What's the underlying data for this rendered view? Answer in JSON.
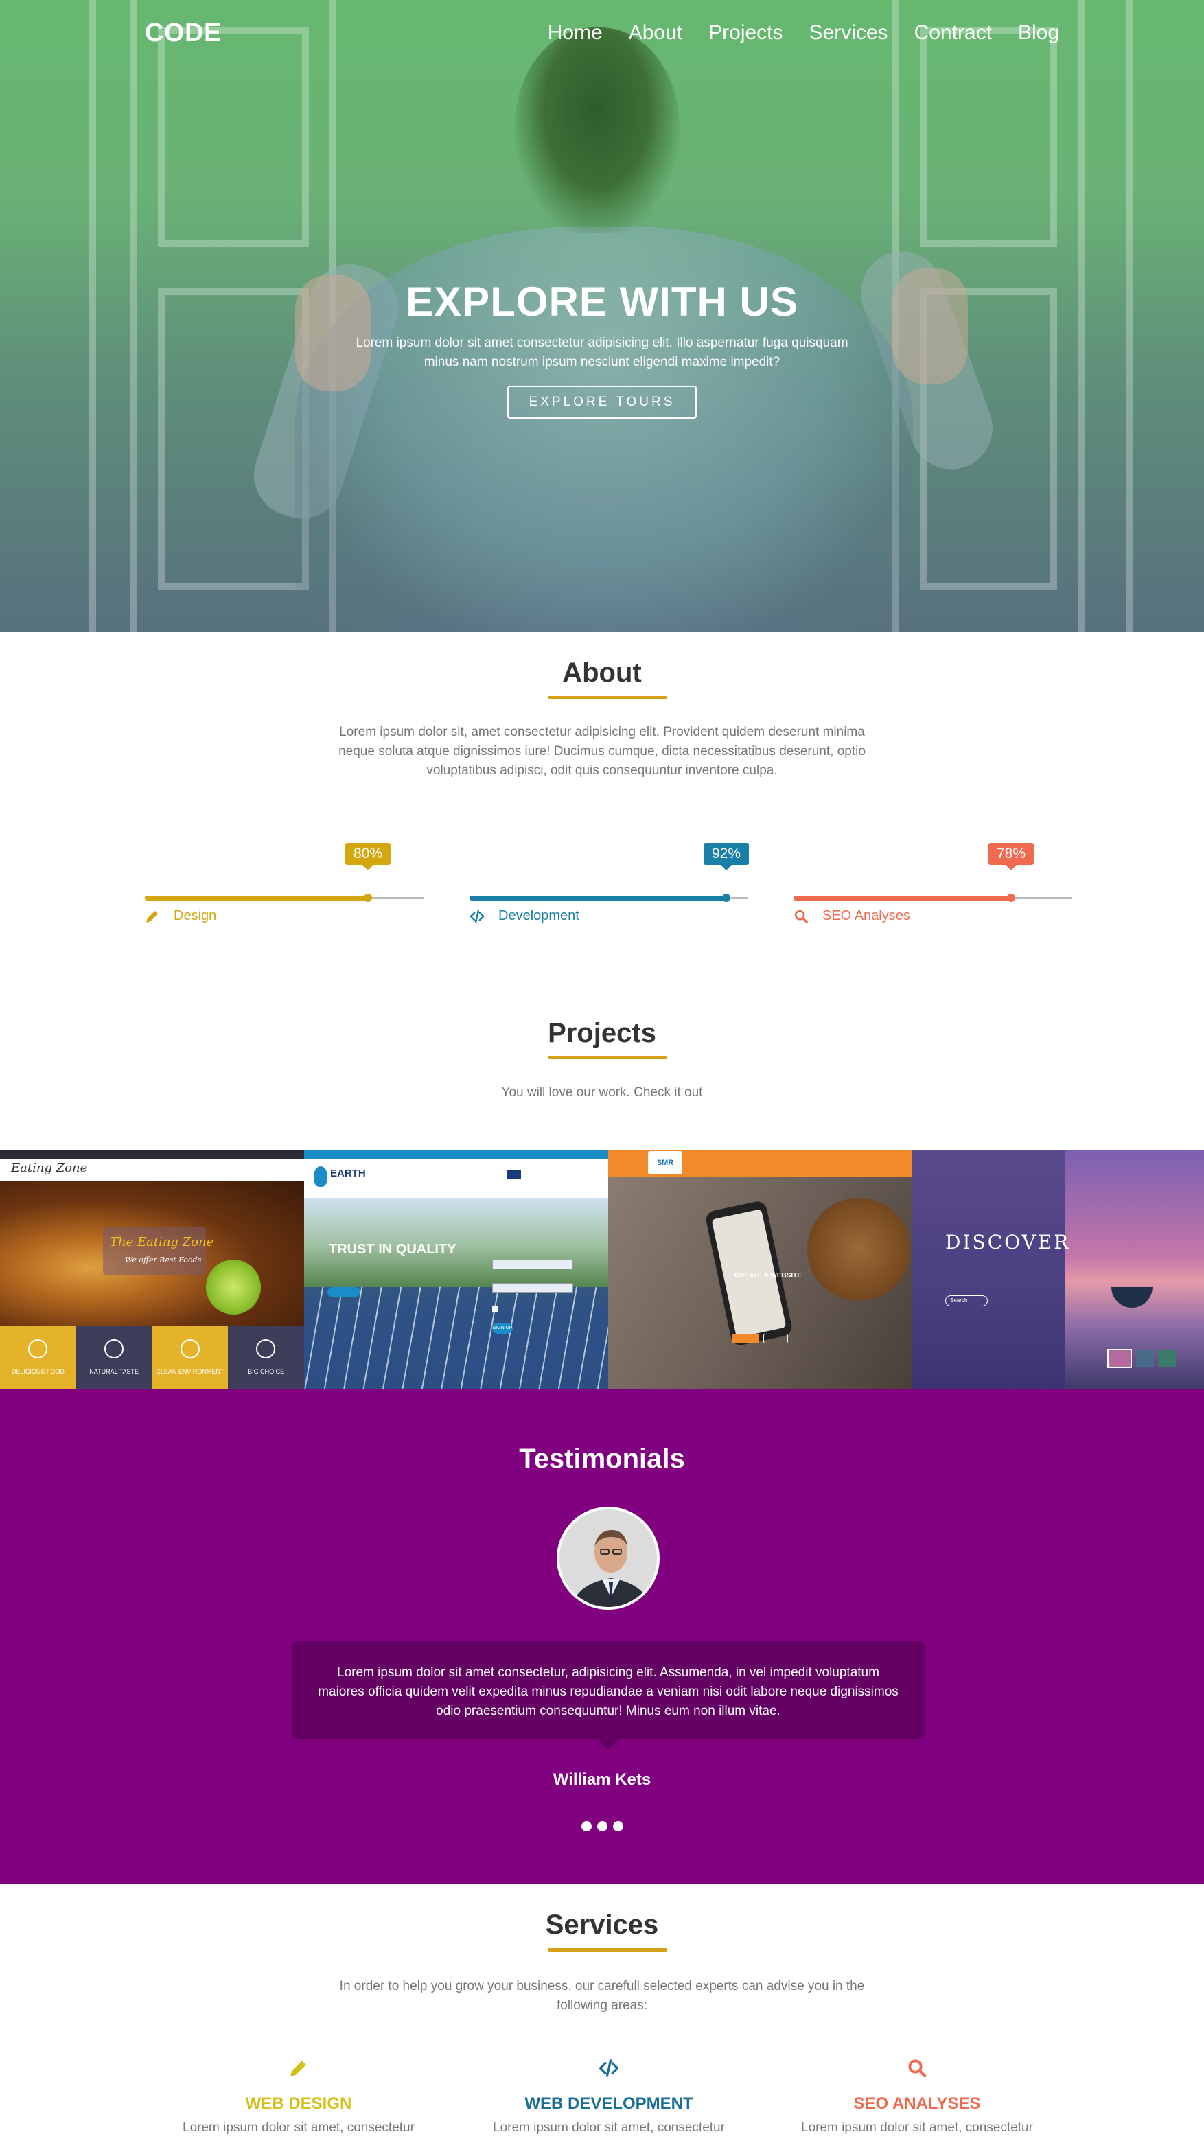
{
  "header": {
    "logo": "CODE",
    "nav": [
      "Home",
      "About",
      "Projects",
      "Services",
      "Contract",
      "Blog"
    ]
  },
  "hero": {
    "title": "EXPLORE WITH US",
    "text": "Lorem ipsum dolor sit amet consectetur adipisicing elit. Illo aspernatur fuga quisquam minus nam nostrum ipsum nesciunt eligendi maxime impedit?",
    "button": "EXPLORE TOURS"
  },
  "about": {
    "title": "About",
    "text": "Lorem ipsum dolor sit, amet consectetur adipisicing elit. Provident quidem deserunt minima neque soluta atque dignissimos iure! Ducimus cumque, dicta necessitatibus deserunt, optio voluptatibus adipisci, odit quis consequuntur inventore culpa.",
    "skills": [
      {
        "name": "Design",
        "percent": "80%",
        "value": 0.8,
        "color": "#d4a60f",
        "icon": "pencil-icon"
      },
      {
        "name": "Development",
        "percent": "92%",
        "value": 0.92,
        "color": "#1a7fa6",
        "icon": "code-icon"
      },
      {
        "name": "SEO Analyses",
        "percent": "78%",
        "value": 0.78,
        "color": "#ef6a4f",
        "icon": "search-icon"
      }
    ]
  },
  "projects": {
    "title": "Projects",
    "subtitle": "You will love our work. Check it out",
    "items": [
      {
        "brand": "Eating Zone",
        "tagline": "The Eating Zone",
        "subtag": "We offer Best Foods",
        "tiles": [
          "DELICIOUS FOOD",
          "NATURAL TASTE",
          "CLEAN ENVIRONMENT",
          "BIG CHOICE"
        ]
      },
      {
        "brand": "EARTH",
        "headline": "TRUST IN QUALITY",
        "button": "SIGN UP"
      },
      {
        "brand": "SMR",
        "headline": "CREATE A WEBSITE"
      },
      {
        "headline": "DISCOVER",
        "button": "Search"
      }
    ]
  },
  "testimonials": {
    "title": "Testimonials",
    "quote": "Lorem ipsum dolor sit amet consectetur, adipisicing elit. Assumenda, in vel impedit voluptatum maiores officia quidem velit expedita minus repudiandae a veniam nisi odit labore neque dignissimos odio praesentium consequuntur! Minus eum non illum vitae.",
    "name": "William Kets"
  },
  "services": {
    "title": "Services",
    "subtitle": "In order to help you grow your business. our carefull selected experts can advise you in the following areas:",
    "items": [
      {
        "name": "WEB DESIGN",
        "desc": "Lorem ipsum dolor sit amet, consectetur",
        "color": "#d4c01a",
        "icon": "pencil-icon"
      },
      {
        "name": "WEB DEVELOPMENT",
        "desc": "Lorem ipsum dolor sit amet, consectetur",
        "color": "#1a6f96",
        "icon": "code-icon"
      },
      {
        "name": "SEO ANALYSES",
        "desc": "Lorem ipsum dolor sit amet, consectetur",
        "color": "#ef6a4f",
        "icon": "search-icon"
      }
    ]
  }
}
